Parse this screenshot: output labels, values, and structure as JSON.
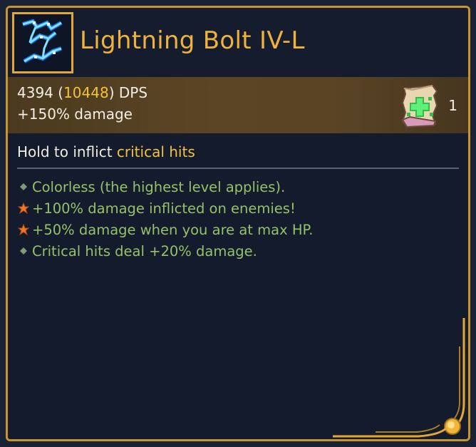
{
  "item": {
    "title": "Lightning Bolt IV-L",
    "icon": "lightning-bolt-icon"
  },
  "stats": {
    "dps_base": "4394",
    "dps_boosted": "10448",
    "dps_unit": "DPS",
    "damage_bonus": "+150% damage",
    "scroll_icon": "healing-scroll-icon",
    "scroll_count": "1"
  },
  "description": {
    "prefix": "Hold to inflict ",
    "highlight": "critical hits"
  },
  "effects": [
    {
      "bullet": "diamond-bullet-icon",
      "text": "Colorless (the highest level applies)."
    },
    {
      "bullet": "orange-star-icon",
      "text": "+100% damage inflicted on enemies!"
    },
    {
      "bullet": "orange-star-icon",
      "text": "+50% damage when you are at max HP."
    },
    {
      "bullet": "diamond-bullet-icon",
      "text": "Critical hits deal +20% damage."
    }
  ],
  "colors": {
    "border": "#c8952c",
    "title": "#f0b23a",
    "highlight": "#f2c23c",
    "effect_text": "#96c16a",
    "panel_bg": "#131b2c"
  }
}
